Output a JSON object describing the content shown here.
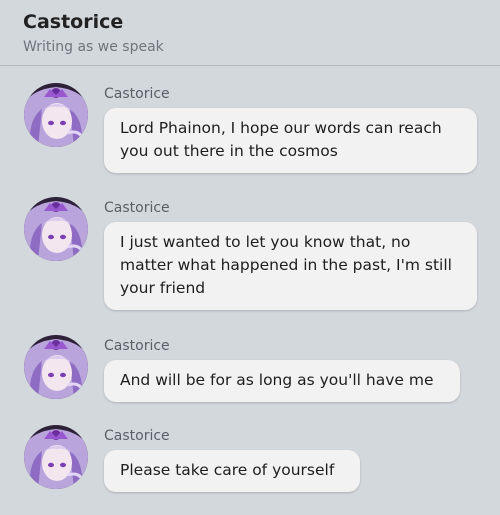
{
  "chat": {
    "title": "Castorice",
    "status": "Writing as we speak"
  },
  "messages": [
    {
      "sender": "Castorice",
      "text": "Lord Phainon, I hope our words can reach you out there in the cosmos",
      "avatar": "castorice-avatar"
    },
    {
      "sender": "Castorice",
      "text": "I just wanted to let you know that, no matter what happened in the past, I'm still your friend",
      "avatar": "castorice-avatar"
    },
    {
      "sender": "Castorice",
      "text": "And will be for as long as you'll have me",
      "avatar": "castorice-avatar"
    },
    {
      "sender": "Castorice",
      "text": "Please take care of yourself",
      "avatar": "castorice-avatar"
    }
  ],
  "colors": {
    "background": "#d3d8dd",
    "bubble": "#f2f2f2",
    "avatar_hair": "#c9b6e6",
    "avatar_accent": "#7a3fb0"
  }
}
